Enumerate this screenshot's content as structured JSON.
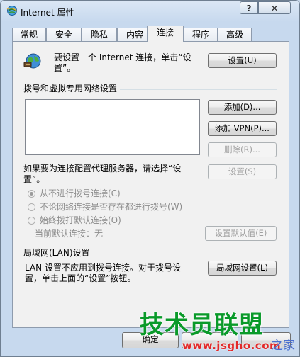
{
  "window": {
    "title": "Internet 属性",
    "help_label": "?",
    "close_label": "✕"
  },
  "tabs": [
    {
      "label": "常规"
    },
    {
      "label": "安全"
    },
    {
      "label": "隐私"
    },
    {
      "label": "内容"
    },
    {
      "label": "连接"
    },
    {
      "label": "程序"
    },
    {
      "label": "高级"
    }
  ],
  "setup": {
    "text_line1": "要设置一个 Internet 连接，单击“设",
    "text_line2": "置”。",
    "button": "设置(U)"
  },
  "dialup": {
    "heading": "拨号和虚拟专用网络设置",
    "add_button": "添加(D)...",
    "add_vpn_button": "添加 VPN(P)...",
    "remove_button": "删除(R)...",
    "settings_button": "设置(S)",
    "proxy_text_line1": "如果要为连接配置代理服务器，请选择“设",
    "proxy_text_line2": "置”。",
    "options": [
      {
        "label": "从不进行拨号连接(C)",
        "checked": true
      },
      {
        "label": "不论网络连接是否存在都进行拨号(W)",
        "checked": false
      },
      {
        "label": "始终拨打默认连接(O)",
        "checked": false
      }
    ],
    "current_default": "当前默认连接：无",
    "set_default_button": "设置默认值(E)"
  },
  "lan": {
    "heading": "局域网(LAN)设置",
    "text_line1": "LAN 设置不应用到拨号连接。对于拨号设",
    "text_line2": "置，单击上面的“设置”按钮。",
    "button": "局域网设置(L)"
  },
  "bottom": {
    "ok_label": "确定"
  },
  "watermark": {
    "text": "技术员联盟",
    "url": "www.jsgho.com",
    "home": "之家"
  }
}
